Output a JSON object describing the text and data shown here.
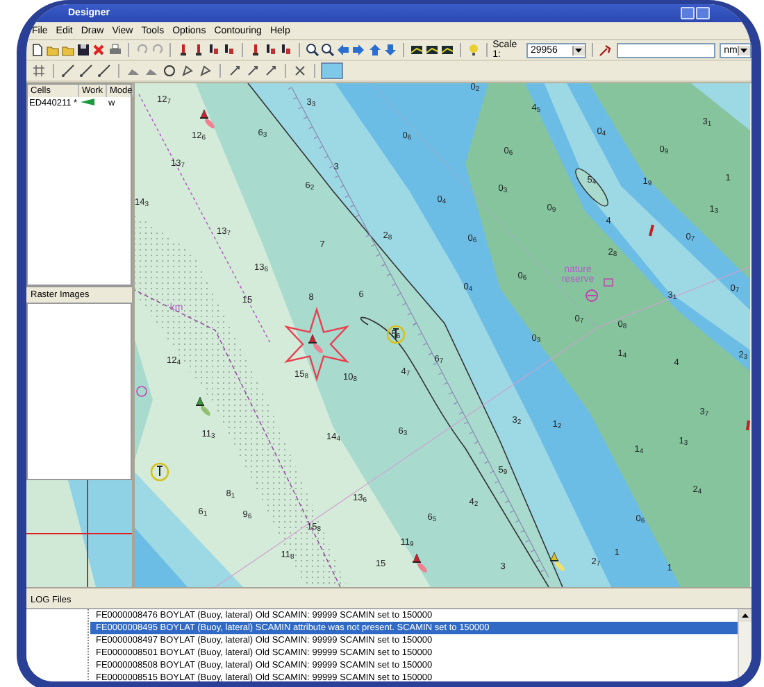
{
  "window": {
    "title": "Designer"
  },
  "menu": [
    "File",
    "Edit",
    "Draw",
    "View",
    "Tools",
    "Options",
    "Contouring",
    "Help"
  ],
  "toolbar": {
    "scale_label": "Scale 1:",
    "scale_value": "29956",
    "unit": "nm"
  },
  "cells": {
    "columns": [
      "Cells",
      "Work",
      "Mode"
    ],
    "rows": [
      {
        "cell": "ED440211 *",
        "mode": "w"
      }
    ]
  },
  "raster_tab": "Raster Images",
  "chart": {
    "soundings": [
      {
        "text": "12$_{7}$"
      },
      {
        "text": "12$_{6}$"
      },
      {
        "text": "13$_{7}$"
      },
      {
        "text": "14$_{3}$"
      },
      {
        "text": "13$_{7}$"
      },
      {
        "text": "6$_{3}$"
      },
      {
        "text": "3$_{3}$"
      },
      {
        "text": "6$_{2}$"
      },
      {
        "text": "3"
      },
      {
        "text": "7"
      },
      {
        "text": "2$_{8}$"
      },
      {
        "text": "0$_{6}$"
      },
      {
        "text": "0$_{2}$"
      },
      {
        "text": "4$_{5}$"
      },
      {
        "text": "0$_{6}$"
      },
      {
        "text": "0$_{3}$"
      },
      {
        "text": "0$_{4}$"
      },
      {
        "text": "0$_{6}$"
      },
      {
        "text": "0$_{9}$"
      },
      {
        "text": "5$_{4}$"
      },
      {
        "text": "0$_{4}$"
      },
      {
        "text": "0$_{9}$"
      },
      {
        "text": "1$_{9}$"
      },
      {
        "text": "1"
      },
      {
        "text": "1$_{3}$"
      },
      {
        "text": "3$_{1}$"
      },
      {
        "text": "4"
      },
      {
        "text": "0$_{7}$"
      },
      {
        "text": "2$_{8}$"
      },
      {
        "text": "0$_{7}$"
      },
      {
        "text": "3$_{1}$"
      },
      {
        "text": "13$_{6}$"
      },
      {
        "text": "15"
      },
      {
        "text": "8"
      },
      {
        "text": "6"
      },
      {
        "text": "0$_{4}$"
      },
      {
        "text": "0$_{6}$"
      },
      {
        "text": "5$_{6}$"
      },
      {
        "text": "0$_{7}$"
      },
      {
        "text": "0$_{8}$"
      },
      {
        "text": "0$_{3}$"
      },
      {
        "text": "1$_{4}$"
      },
      {
        "text": "4"
      },
      {
        "text": "2$_{3}$"
      },
      {
        "text": "12$_{4}$"
      },
      {
        "text": "15$_{8}$"
      },
      {
        "text": "10$_{8}$"
      },
      {
        "text": "4$_{7}$"
      },
      {
        "text": "6$_{7}$"
      },
      {
        "text": "3$_{2}$"
      },
      {
        "text": "1$_{2}$"
      },
      {
        "text": "3$_{7}$"
      },
      {
        "text": "1$_{3}$"
      },
      {
        "text": "1$_{4}$"
      },
      {
        "text": "11$_{3}$"
      },
      {
        "text": "14$_{4}$"
      },
      {
        "text": "6$_{3}$"
      },
      {
        "text": "5$_{9}$"
      },
      {
        "text": "13$_{6}$"
      },
      {
        "text": "4$_{2}$"
      },
      {
        "text": "2$_{4}$"
      },
      {
        "text": "0$_{6}$"
      },
      {
        "text": "8$_{1}$"
      },
      {
        "text": "6$_{1}$"
      },
      {
        "text": "9$_{6}$"
      },
      {
        "text": "15$_{8}$"
      },
      {
        "text": "6$_{5}$"
      },
      {
        "text": "11$_{9}$"
      },
      {
        "text": "11$_{8}$"
      },
      {
        "text": "15"
      },
      {
        "text": "3"
      },
      {
        "text": "2$_{7}$"
      },
      {
        "text": "1"
      },
      {
        "text": "1"
      }
    ],
    "labels": [
      {
        "text": "km"
      },
      {
        "text": "nature reserve"
      }
    ]
  },
  "log": {
    "title": "LOG Files",
    "rows": [
      {
        "text": "FE0000008476 BOYLAT (Buoy, lateral) Old SCAMIN: 99999 SCAMIN set to 150000",
        "selected": false
      },
      {
        "text": "FE0000008495 BOYLAT (Buoy, lateral) SCAMIN attribute was not present. SCAMIN set to 150000",
        "selected": true
      },
      {
        "text": "FE0000008497 BOYLAT (Buoy, lateral) Old SCAMIN: 99999 SCAMIN set to 150000",
        "selected": false
      },
      {
        "text": "FE0000008501 BOYLAT (Buoy, lateral) Old SCAMIN: 99999 SCAMIN set to 150000",
        "selected": false
      },
      {
        "text": "FE0000008508 BOYLAT (Buoy, lateral) Old SCAMIN: 99999 SCAMIN set to 150000",
        "selected": false
      },
      {
        "text": "FE0000008515 BOYLAT (Buoy, lateral) Old SCAMIN: 99999 SCAMIN set to 150000",
        "selected": false
      }
    ]
  }
}
